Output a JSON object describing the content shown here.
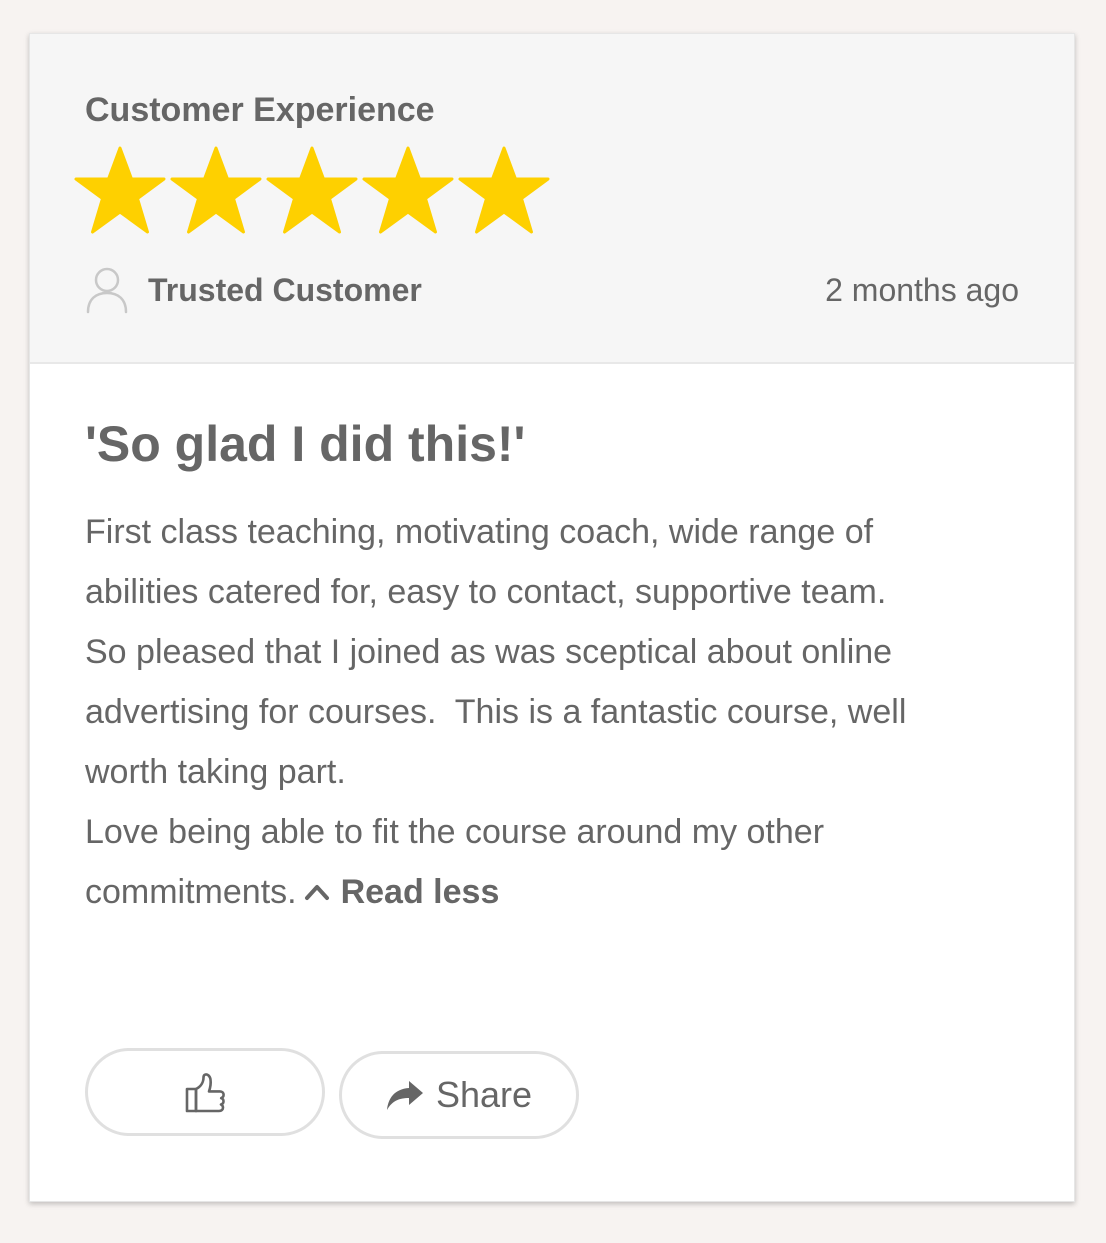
{
  "review": {
    "category": "Customer Experience",
    "rating": 5,
    "rating_max": 5,
    "star_color": "#fed000",
    "reviewer_name": "Trusted Customer",
    "timestamp": "2 months ago",
    "title": "'So glad I did this!'",
    "body_lines": [
      "First class teaching, motivating coach, wide range of",
      "abilities catered for, easy to contact, supportive team.",
      "So pleased that I joined as was sceptical about online",
      "advertising for courses.  This is a fantastic course, well",
      "worth taking part.",
      "Love being able to fit the course around my other",
      "commitments."
    ],
    "read_less_label": "Read less"
  },
  "actions": {
    "like_icon": "thumbs-up-icon",
    "share_icon": "share-arrow-icon",
    "share_label": "Share"
  }
}
